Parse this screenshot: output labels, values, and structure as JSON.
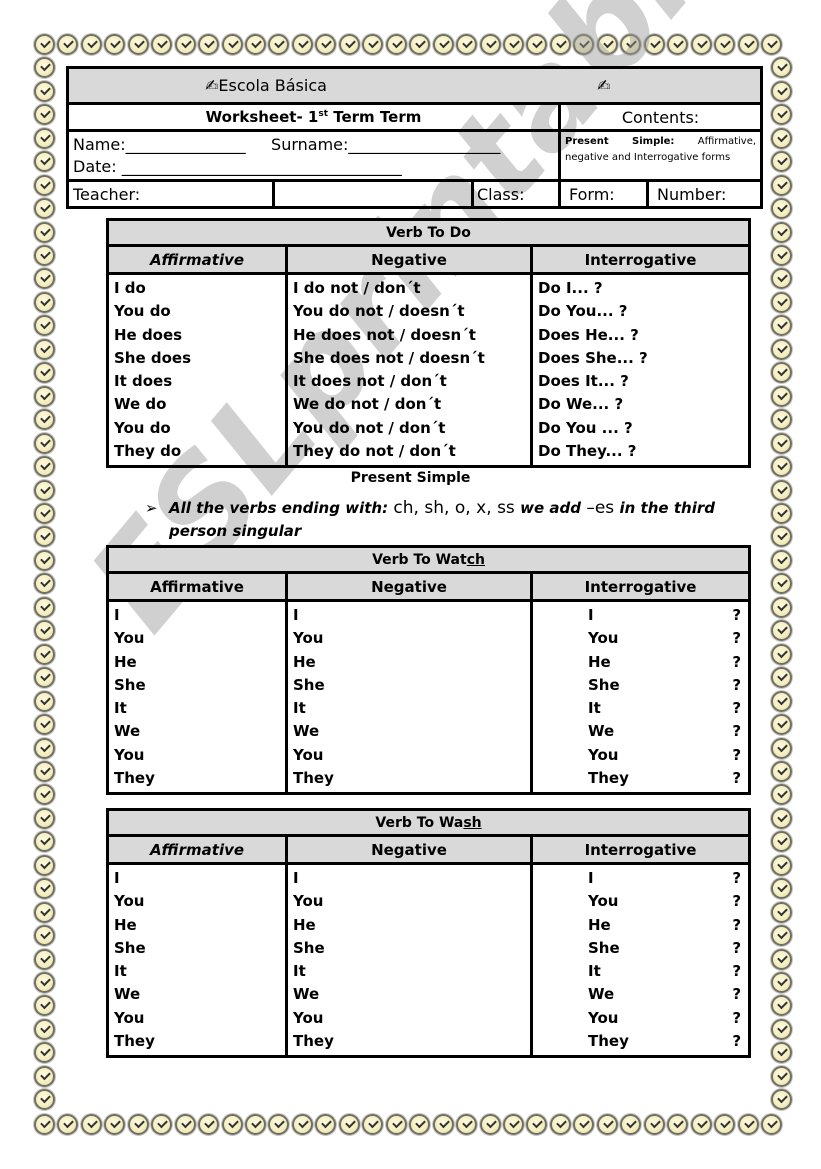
{
  "header": {
    "school_name": "Escola Básica",
    "worksheet_title": "Worksheet- 1st Term Term",
    "contents_label": "Contents:",
    "contents_text_bold": "Present Simple:",
    "contents_text": "Affirmative, negative and Interrogative forms",
    "name_label": "Name:_______________",
    "surname_label": "Surname:___________________",
    "date_label": "Date: ___________________________________",
    "teacher_label": "Teacher:",
    "class_label": "Class:",
    "form_label": "Form:",
    "number_label": "Number:"
  },
  "icons": {
    "pen_icon": "pen-writing",
    "border_icon": "clock"
  },
  "tables": [
    {
      "title": "Verb To Do",
      "columns": [
        "Affirmative",
        "Negative",
        "Interrogative"
      ],
      "affirmative": [
        "I do",
        "You do",
        "He does",
        "She does",
        "It does",
        "We do",
        "You do",
        "They do"
      ],
      "negative": [
        "I do not  / don´t",
        "You do not  / doesn´t",
        "He does not  / doesn´t",
        "She does not  / doesn´t",
        "It does not  / don´t",
        "We do not  / don´t",
        "You do not  / don´t",
        "They do not  / don´t"
      ],
      "interrogative": [
        "Do I... ?",
        "Do You... ?",
        "Does He... ?",
        "Does She... ?",
        "Does It... ?",
        "Do We... ?",
        "Do You ... ?",
        "Do They... ?"
      ]
    },
    {
      "title_prefix": "Verb To Wat",
      "title_underlined": "ch",
      "columns": [
        "Affirmative",
        "Negative",
        "Interrogative"
      ],
      "affirmative": [
        "I",
        "You",
        "He",
        "She",
        "It",
        "We",
        "You",
        "They"
      ],
      "negative": [
        "I",
        "You",
        "He",
        "She",
        "It",
        "We",
        "You",
        "They"
      ],
      "interrogative": [
        "I",
        "You",
        "He",
        "She",
        "It",
        "We",
        "You",
        "They"
      ],
      "question_mark": "?"
    },
    {
      "title_prefix": "Verb To Wa",
      "title_underlined": "sh",
      "columns": [
        "Affirmative",
        "Negative",
        "Interrogative"
      ],
      "affirmative": [
        "I",
        "You",
        "He",
        "She",
        "It",
        "We",
        "You",
        "They"
      ],
      "negative": [
        "I",
        "You",
        "He",
        "She",
        "It",
        "We",
        "You",
        "They"
      ],
      "interrogative": [
        "I",
        "You",
        "He",
        "She",
        "It",
        "We",
        "You",
        "They"
      ],
      "question_mark": "?"
    }
  ],
  "rule": {
    "section_title": "Present Simple",
    "bullet_symbol": "➢",
    "text_before": "All the verbs ending with:",
    "endings": "ch, sh, o, x, ss",
    "text_middle": "we add",
    "suffix": "–es",
    "text_after": "in the third person singular"
  },
  "watermark": "ESLprintables.com"
}
